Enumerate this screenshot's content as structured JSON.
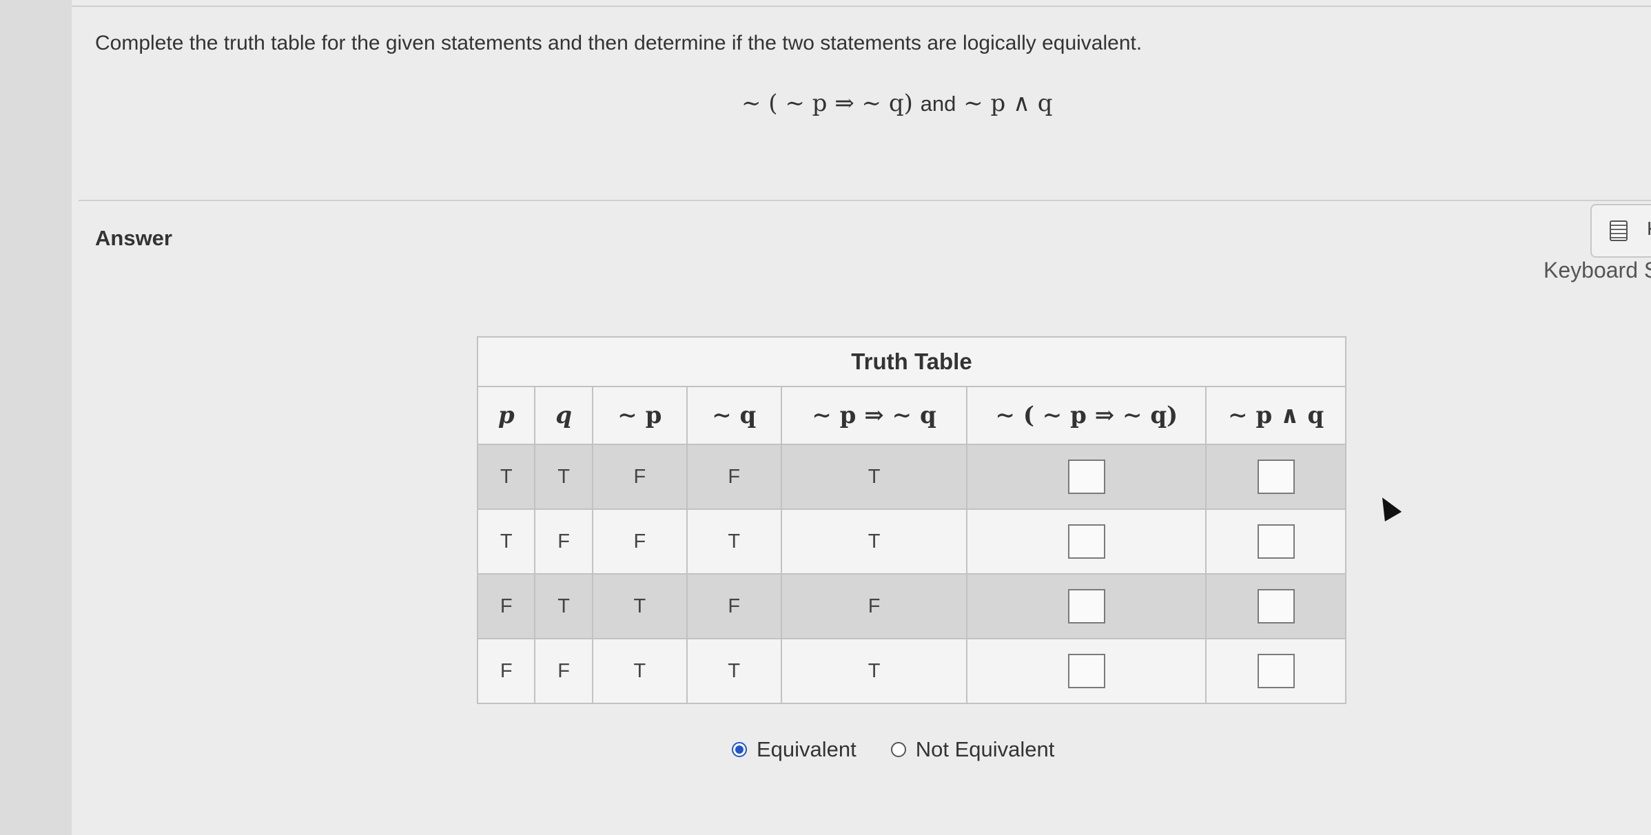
{
  "question": {
    "text": "Complete the truth table for the given statements and then determine if the two statements are logically equivalent.",
    "statement_left": "∼ ( ∼ p ⇒  ∼ q)",
    "statement_and": "and",
    "statement_right": "∼ p ∧ q"
  },
  "answer_label": "Answer",
  "keyboard": {
    "icon": "calculator-icon",
    "button_text": "K",
    "label": "Keyboard S"
  },
  "truth_table": {
    "caption": "Truth Table",
    "headers": [
      "p",
      "q",
      "∼ p",
      "∼ q",
      "∼ p ⇒  ∼ q",
      "∼ ( ∼ p ⇒  ∼ q)",
      "∼ p ∧ q"
    ],
    "rows": [
      [
        "T",
        "T",
        "F",
        "F",
        "T",
        "",
        ""
      ],
      [
        "T",
        "F",
        "F",
        "T",
        "T",
        "",
        ""
      ],
      [
        "F",
        "T",
        "T",
        "F",
        "F",
        "",
        ""
      ],
      [
        "F",
        "F",
        "T",
        "T",
        "T",
        "",
        ""
      ]
    ]
  },
  "choices": {
    "equivalent": "Equivalent",
    "not_equivalent": "Not Equivalent",
    "selected": "equivalent"
  }
}
